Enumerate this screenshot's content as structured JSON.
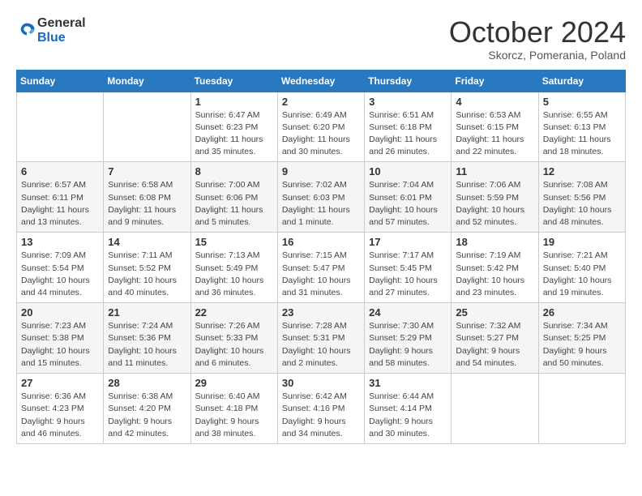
{
  "header": {
    "logo": {
      "line1": "General",
      "line2": "Blue"
    },
    "title": "October 2024",
    "subtitle": "Skorcz, Pomerania, Poland"
  },
  "weekdays": [
    "Sunday",
    "Monday",
    "Tuesday",
    "Wednesday",
    "Thursday",
    "Friday",
    "Saturday"
  ],
  "weeks": [
    [
      {
        "day": "",
        "info": ""
      },
      {
        "day": "",
        "info": ""
      },
      {
        "day": "1",
        "sunrise": "6:47 AM",
        "sunset": "6:23 PM",
        "daylight": "11 hours and 35 minutes."
      },
      {
        "day": "2",
        "sunrise": "6:49 AM",
        "sunset": "6:20 PM",
        "daylight": "11 hours and 30 minutes."
      },
      {
        "day": "3",
        "sunrise": "6:51 AM",
        "sunset": "6:18 PM",
        "daylight": "11 hours and 26 minutes."
      },
      {
        "day": "4",
        "sunrise": "6:53 AM",
        "sunset": "6:15 PM",
        "daylight": "11 hours and 22 minutes."
      },
      {
        "day": "5",
        "sunrise": "6:55 AM",
        "sunset": "6:13 PM",
        "daylight": "11 hours and 18 minutes."
      }
    ],
    [
      {
        "day": "6",
        "sunrise": "6:57 AM",
        "sunset": "6:11 PM",
        "daylight": "11 hours and 13 minutes."
      },
      {
        "day": "7",
        "sunrise": "6:58 AM",
        "sunset": "6:08 PM",
        "daylight": "11 hours and 9 minutes."
      },
      {
        "day": "8",
        "sunrise": "7:00 AM",
        "sunset": "6:06 PM",
        "daylight": "11 hours and 5 minutes."
      },
      {
        "day": "9",
        "sunrise": "7:02 AM",
        "sunset": "6:03 PM",
        "daylight": "11 hours and 1 minute."
      },
      {
        "day": "10",
        "sunrise": "7:04 AM",
        "sunset": "6:01 PM",
        "daylight": "10 hours and 57 minutes."
      },
      {
        "day": "11",
        "sunrise": "7:06 AM",
        "sunset": "5:59 PM",
        "daylight": "10 hours and 52 minutes."
      },
      {
        "day": "12",
        "sunrise": "7:08 AM",
        "sunset": "5:56 PM",
        "daylight": "10 hours and 48 minutes."
      }
    ],
    [
      {
        "day": "13",
        "sunrise": "7:09 AM",
        "sunset": "5:54 PM",
        "daylight": "10 hours and 44 minutes."
      },
      {
        "day": "14",
        "sunrise": "7:11 AM",
        "sunset": "5:52 PM",
        "daylight": "10 hours and 40 minutes."
      },
      {
        "day": "15",
        "sunrise": "7:13 AM",
        "sunset": "5:49 PM",
        "daylight": "10 hours and 36 minutes."
      },
      {
        "day": "16",
        "sunrise": "7:15 AM",
        "sunset": "5:47 PM",
        "daylight": "10 hours and 31 minutes."
      },
      {
        "day": "17",
        "sunrise": "7:17 AM",
        "sunset": "5:45 PM",
        "daylight": "10 hours and 27 minutes."
      },
      {
        "day": "18",
        "sunrise": "7:19 AM",
        "sunset": "5:42 PM",
        "daylight": "10 hours and 23 minutes."
      },
      {
        "day": "19",
        "sunrise": "7:21 AM",
        "sunset": "5:40 PM",
        "daylight": "10 hours and 19 minutes."
      }
    ],
    [
      {
        "day": "20",
        "sunrise": "7:23 AM",
        "sunset": "5:38 PM",
        "daylight": "10 hours and 15 minutes."
      },
      {
        "day": "21",
        "sunrise": "7:24 AM",
        "sunset": "5:36 PM",
        "daylight": "10 hours and 11 minutes."
      },
      {
        "day": "22",
        "sunrise": "7:26 AM",
        "sunset": "5:33 PM",
        "daylight": "10 hours and 6 minutes."
      },
      {
        "day": "23",
        "sunrise": "7:28 AM",
        "sunset": "5:31 PM",
        "daylight": "10 hours and 2 minutes."
      },
      {
        "day": "24",
        "sunrise": "7:30 AM",
        "sunset": "5:29 PM",
        "daylight": "9 hours and 58 minutes."
      },
      {
        "day": "25",
        "sunrise": "7:32 AM",
        "sunset": "5:27 PM",
        "daylight": "9 hours and 54 minutes."
      },
      {
        "day": "26",
        "sunrise": "7:34 AM",
        "sunset": "5:25 PM",
        "daylight": "9 hours and 50 minutes."
      }
    ],
    [
      {
        "day": "27",
        "sunrise": "6:36 AM",
        "sunset": "4:23 PM",
        "daylight": "9 hours and 46 minutes."
      },
      {
        "day": "28",
        "sunrise": "6:38 AM",
        "sunset": "4:20 PM",
        "daylight": "9 hours and 42 minutes."
      },
      {
        "day": "29",
        "sunrise": "6:40 AM",
        "sunset": "4:18 PM",
        "daylight": "9 hours and 38 minutes."
      },
      {
        "day": "30",
        "sunrise": "6:42 AM",
        "sunset": "4:16 PM",
        "daylight": "9 hours and 34 minutes."
      },
      {
        "day": "31",
        "sunrise": "6:44 AM",
        "sunset": "4:14 PM",
        "daylight": "9 hours and 30 minutes."
      },
      {
        "day": "",
        "info": ""
      },
      {
        "day": "",
        "info": ""
      }
    ]
  ]
}
